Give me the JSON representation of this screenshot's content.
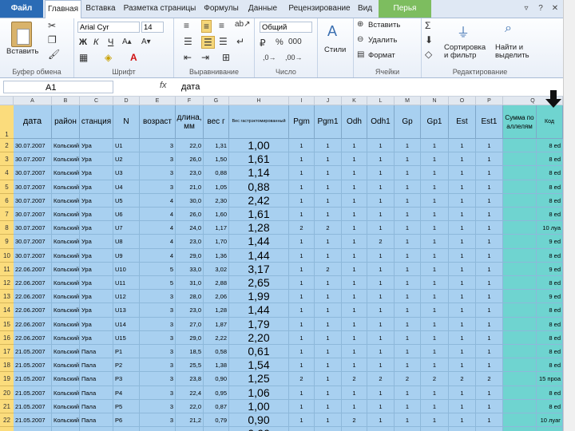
{
  "tabs": [
    "Файл",
    "Главная",
    "Вставка",
    "Разметка страницы",
    "Формулы",
    "Данные",
    "Рецензирование",
    "Вид",
    "Перья"
  ],
  "ribbon": {
    "paste": "Вставить",
    "clipboard": "Буфер обмена",
    "font_name": "Arial Cyr",
    "font_size": "14",
    "font_group": "Шрифт",
    "align_group": "Выравнивание",
    "number_format": "Общий",
    "number_group": "Число",
    "styles": "Стили",
    "insert": "Вставить",
    "delete": "Удалить",
    "format": "Формат",
    "cells_group": "Ячейки",
    "sort": "Сортировка и фильтр",
    "find": "Найти и выделить",
    "edit_group": "Редактирование",
    "bold": "Ж",
    "italic": "К",
    "underline": "Ч",
    "sigma": "Σ"
  },
  "formula_bar": {
    "name_box": "A1",
    "fx": "fx",
    "value": "дата"
  },
  "columns": [
    "A",
    "B",
    "C",
    "D",
    "E",
    "F",
    "G",
    "H",
    "I",
    "J",
    "K",
    "L",
    "M",
    "N",
    "O",
    "P",
    "Q"
  ],
  "headers": [
    "дата",
    "район",
    "станция",
    "N",
    "возраст",
    "длина, мм",
    "вес г",
    "Вес гастрэктомированный",
    "Pgm",
    "Pgm1",
    "Odh",
    "Odh1",
    "Gp",
    "Gp1",
    "Est",
    "Est1",
    "Сумма по аллелям",
    "Код"
  ],
  "rows": [
    {
      "n": "2",
      "a": "30.07.2007",
      "b": "Кольский",
      "c": "Ура",
      "d": "U1",
      "e": "3",
      "f": "22,0",
      "g": "1,31",
      "h": "1,00",
      "i": "1",
      "j": "1",
      "k": "1",
      "l": "1",
      "m": "1",
      "nn": "1",
      "o": "1",
      "p": "1",
      "q": "8 ed"
    },
    {
      "n": "3",
      "a": "30.07.2007",
      "b": "Кольский",
      "c": "Ура",
      "d": "U2",
      "e": "3",
      "f": "26,0",
      "g": "1,50",
      "h": "1,61",
      "i": "1",
      "j": "1",
      "k": "1",
      "l": "1",
      "m": "1",
      "nn": "1",
      "o": "1",
      "p": "1",
      "q": "8 ed"
    },
    {
      "n": "4",
      "a": "30.07.2007",
      "b": "Кольский",
      "c": "Ура",
      "d": "U3",
      "e": "3",
      "f": "23,0",
      "g": "0,88",
      "h": "1,14",
      "i": "1",
      "j": "1",
      "k": "1",
      "l": "1",
      "m": "1",
      "nn": "1",
      "o": "1",
      "p": "1",
      "q": "8 ed"
    },
    {
      "n": "5",
      "a": "30.07.2007",
      "b": "Кольский",
      "c": "Ура",
      "d": "U4",
      "e": "3",
      "f": "21,0",
      "g": "1,05",
      "h": "0,88",
      "i": "1",
      "j": "1",
      "k": "1",
      "l": "1",
      "m": "1",
      "nn": "1",
      "o": "1",
      "p": "1",
      "q": "8 ed"
    },
    {
      "n": "6",
      "a": "30.07.2007",
      "b": "Кольский",
      "c": "Ура",
      "d": "U5",
      "e": "4",
      "f": "30,0",
      "g": "2,30",
      "h": "2,42",
      "i": "1",
      "j": "1",
      "k": "1",
      "l": "1",
      "m": "1",
      "nn": "1",
      "o": "1",
      "p": "1",
      "q": "8 ed"
    },
    {
      "n": "7",
      "a": "30.07.2007",
      "b": "Кольский",
      "c": "Ура",
      "d": "U6",
      "e": "4",
      "f": "26,0",
      "g": "1,60",
      "h": "1,61",
      "i": "1",
      "j": "1",
      "k": "1",
      "l": "1",
      "m": "1",
      "nn": "1",
      "o": "1",
      "p": "1",
      "q": "8 ed"
    },
    {
      "n": "8",
      "a": "30.07.2007",
      "b": "Кольский",
      "c": "Ура",
      "d": "U7",
      "e": "4",
      "f": "24,0",
      "g": "1,17",
      "h": "1,28",
      "i": "2",
      "j": "2",
      "k": "1",
      "l": "1",
      "m": "1",
      "nn": "1",
      "o": "1",
      "p": "1",
      "q": "10 луа"
    },
    {
      "n": "9",
      "a": "30.07.2007",
      "b": "Кольский",
      "c": "Ура",
      "d": "U8",
      "e": "4",
      "f": "23,0",
      "g": "1,70",
      "h": "1,44",
      "i": "1",
      "j": "1",
      "k": "1",
      "l": "2",
      "m": "1",
      "nn": "1",
      "o": "1",
      "p": "1",
      "q": "9 ed"
    },
    {
      "n": "10",
      "a": "30.07.2007",
      "b": "Кольский",
      "c": "Ура",
      "d": "U9",
      "e": "4",
      "f": "29,0",
      "g": "1,36",
      "h": "1,44",
      "i": "1",
      "j": "1",
      "k": "1",
      "l": "1",
      "m": "1",
      "nn": "1",
      "o": "1",
      "p": "1",
      "q": "8 ed"
    },
    {
      "n": "11",
      "a": "22.06.2007",
      "b": "Кольский",
      "c": "Ура",
      "d": "U10",
      "e": "5",
      "f": "33,0",
      "g": "3,02",
      "h": "3,17",
      "i": "1",
      "j": "2",
      "k": "1",
      "l": "1",
      "m": "1",
      "nn": "1",
      "o": "1",
      "p": "1",
      "q": "9 ed"
    },
    {
      "n": "12",
      "a": "22.06.2007",
      "b": "Кольский",
      "c": "Ура",
      "d": "U11",
      "e": "5",
      "f": "31,0",
      "g": "2,88",
      "h": "2,65",
      "i": "1",
      "j": "1",
      "k": "1",
      "l": "1",
      "m": "1",
      "nn": "1",
      "o": "1",
      "p": "1",
      "q": "8 ed"
    },
    {
      "n": "13",
      "a": "22.06.2007",
      "b": "Кольский",
      "c": "Ура",
      "d": "U12",
      "e": "3",
      "f": "28,0",
      "g": "2,06",
      "h": "1,99",
      "i": "1",
      "j": "1",
      "k": "1",
      "l": "1",
      "m": "1",
      "nn": "1",
      "o": "1",
      "p": "1",
      "q": "9 ed"
    },
    {
      "n": "14",
      "a": "22.06.2007",
      "b": "Кольский",
      "c": "Ура",
      "d": "U13",
      "e": "3",
      "f": "23,0",
      "g": "1,28",
      "h": "1,44",
      "i": "1",
      "j": "1",
      "k": "1",
      "l": "1",
      "m": "1",
      "nn": "1",
      "o": "1",
      "p": "1",
      "q": "8 ed"
    },
    {
      "n": "15",
      "a": "22.06.2007",
      "b": "Кольский",
      "c": "Ура",
      "d": "U14",
      "e": "3",
      "f": "27,0",
      "g": "1,87",
      "h": "1,79",
      "i": "1",
      "j": "1",
      "k": "1",
      "l": "1",
      "m": "1",
      "nn": "1",
      "o": "1",
      "p": "1",
      "q": "8 ed"
    },
    {
      "n": "16",
      "a": "22.06.2007",
      "b": "Кольский",
      "c": "Ура",
      "d": "U15",
      "e": "3",
      "f": "29,0",
      "g": "2,22",
      "h": "2,20",
      "i": "1",
      "j": "1",
      "k": "1",
      "l": "1",
      "m": "1",
      "nn": "1",
      "o": "1",
      "p": "1",
      "q": "8 ed"
    },
    {
      "n": "17",
      "a": "21.05.2007",
      "b": "Кольский",
      "c": "Пала",
      "d": "P1",
      "e": "3",
      "f": "18,5",
      "g": "0,58",
      "h": "0,61",
      "i": "1",
      "j": "1",
      "k": "1",
      "l": "1",
      "m": "1",
      "nn": "1",
      "o": "1",
      "p": "1",
      "q": "8 ed"
    },
    {
      "n": "18",
      "a": "21.05.2007",
      "b": "Кольский",
      "c": "Пала",
      "d": "P2",
      "e": "3",
      "f": "25,5",
      "g": "1,38",
      "h": "1,54",
      "i": "1",
      "j": "1",
      "k": "1",
      "l": "1",
      "m": "1",
      "nn": "1",
      "o": "1",
      "p": "1",
      "q": "8 ed"
    },
    {
      "n": "19",
      "a": "21.05.2007",
      "b": "Кольский",
      "c": "Пала",
      "d": "P3",
      "e": "3",
      "f": "23,8",
      "g": "0,90",
      "h": "1,25",
      "i": "2",
      "j": "1",
      "k": "2",
      "l": "2",
      "m": "2",
      "nn": "2",
      "o": "2",
      "p": "2",
      "q": "15 проа"
    },
    {
      "n": "20",
      "a": "21.05.2007",
      "b": "Кольский",
      "c": "Пала",
      "d": "P4",
      "e": "3",
      "f": "22,4",
      "g": "0,95",
      "h": "1,06",
      "i": "1",
      "j": "1",
      "k": "1",
      "l": "1",
      "m": "1",
      "nn": "1",
      "o": "1",
      "p": "1",
      "q": "8 ed"
    },
    {
      "n": "21",
      "a": "21.05.2007",
      "b": "Кольский",
      "c": "Пала",
      "d": "P5",
      "e": "3",
      "f": "22,0",
      "g": "0,87",
      "h": "1,00",
      "i": "1",
      "j": "1",
      "k": "1",
      "l": "1",
      "m": "1",
      "nn": "1",
      "o": "1",
      "p": "1",
      "q": "8 ed"
    },
    {
      "n": "22",
      "a": "21.05.2007",
      "b": "Кольский",
      "c": "Пала",
      "d": "P6",
      "e": "3",
      "f": "21,2",
      "g": "0,79",
      "h": "0,90",
      "i": "1",
      "j": "1",
      "k": "2",
      "l": "1",
      "m": "1",
      "nn": "1",
      "o": "1",
      "p": "1",
      "q": "10 луаг"
    },
    {
      "n": "23",
      "a": "21.05.2007",
      "b": "Кольский",
      "c": "Пала",
      "d": "P7",
      "e": "3",
      "f": "18,9",
      "g": "0,74",
      "h": "0,66",
      "i": "1",
      "j": "1",
      "k": "1",
      "l": "1",
      "m": "1",
      "nn": "1",
      "o": "1",
      "p": "1",
      "q": "8 ed"
    }
  ]
}
